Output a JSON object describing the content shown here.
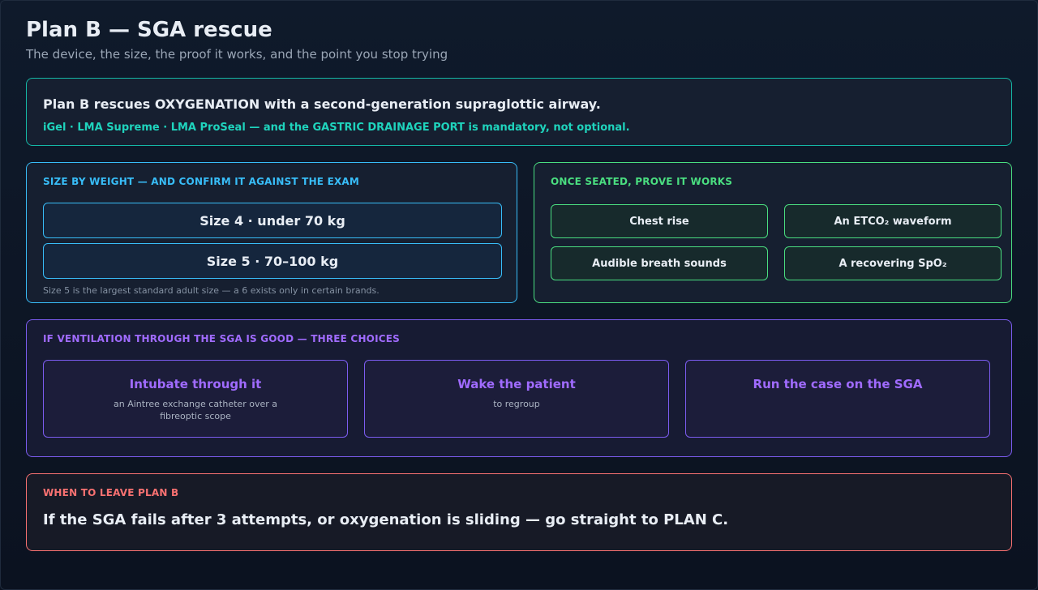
{
  "header": {
    "title": "Plan B — SGA rescue",
    "subtitle": "The device, the size, the proof it works, and the point you stop trying"
  },
  "intro": {
    "line1": "Plan B rescues OXYGENATION with a second-generation supraglottic airway.",
    "line2": "iGel · LMA Supreme · LMA ProSeal — and the GASTRIC DRAINAGE PORT is mandatory, not optional."
  },
  "sizing": {
    "heading": "SIZE BY WEIGHT — AND CONFIRM IT AGAINST THE EXAM",
    "sizes": [
      "Size 4 · under 70 kg",
      "Size 5 · 70–100 kg"
    ],
    "note": "Size 5 is the largest standard adult size — a 6 exists only in certain brands."
  },
  "confirm": {
    "heading": "ONCE SEATED, PROVE IT WORKS",
    "signs": [
      "Chest rise",
      "An ETCO₂ waveform",
      "Audible breath sounds",
      "A recovering SpO₂"
    ]
  },
  "ventilation": {
    "heading": "IF VENTILATION THROUGH THE SGA IS GOOD — THREE CHOICES",
    "choices": [
      {
        "title": "Intubate through it",
        "detail": "an Aintree exchange catheter over a fibreoptic scope"
      },
      {
        "title": "Wake the patient",
        "detail": "to regroup"
      },
      {
        "title": "Run the case on the SGA",
        "detail": ""
      }
    ]
  },
  "exit": {
    "heading": "WHEN TO LEAVE PLAN B",
    "text": "If the SGA fails after 3 attempts, or oxygenation is sliding — go straight to PLAN C."
  },
  "colors": {
    "teal": "#14b8a6",
    "sky": "#38bdf8",
    "green": "#4ade80",
    "violet": "#a06bff",
    "red": "#f87171"
  }
}
